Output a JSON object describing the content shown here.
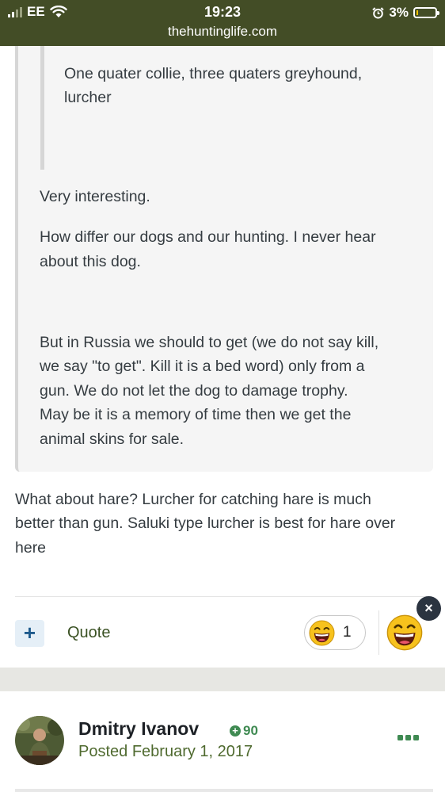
{
  "status_bar": {
    "carrier": "EE",
    "time": "19:23",
    "url": "thehuntinglife.com",
    "battery": "3%"
  },
  "quoted_post": {
    "nested_quote": [
      "One quater collie, three quaters greyhound,",
      "lurcher"
    ],
    "paragraphs": [
      [
        "Very interesting."
      ],
      [
        "How differ our dogs and our hunting. I never hear",
        "about this dog."
      ],
      [
        "But in Russia we should to get (we do not say kill,",
        "we say \"to get\". Kill it is a bed word) only from a",
        "gun. We do not let the dog to damage trophy.",
        "May be it is a memory of time then we get the",
        "animal skins for sale."
      ]
    ]
  },
  "reply": [
    "What about hare? Lurcher for catching hare is much",
    "better than gun. Saluki type lurcher is best for hare over",
    "here"
  ],
  "actions": {
    "add_button": "+",
    "quote_label": "Quote",
    "reaction_count": "1",
    "close_label": "×"
  },
  "next_post": {
    "author": "Dmitry Ivanov",
    "reputation": "90",
    "posted": "Posted February 1, 2017"
  },
  "colors": {
    "status_bar": "#434d26",
    "accent_green": "#3f8a52",
    "quote_link": "#3b5224",
    "quote_bg": "#f5f5f5"
  }
}
